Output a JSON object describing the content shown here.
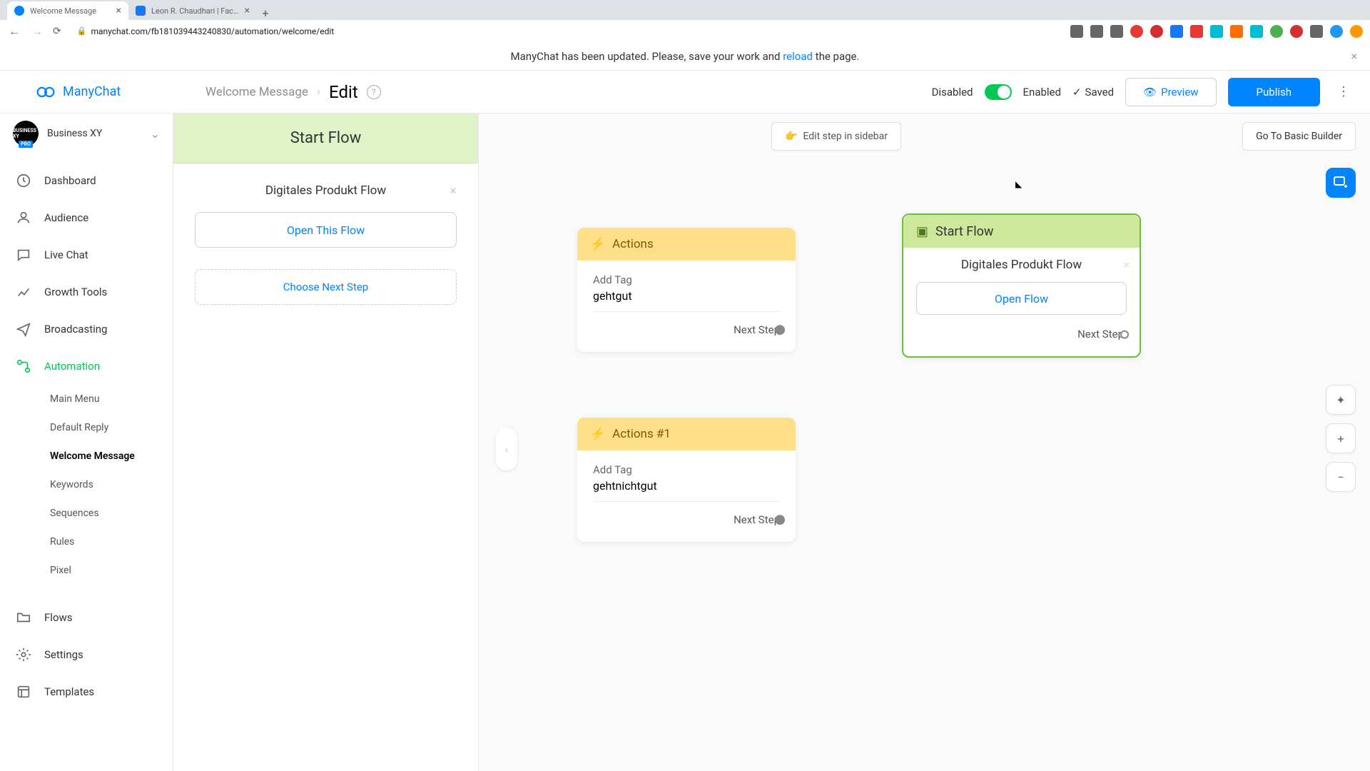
{
  "browser": {
    "tabs": [
      {
        "title": "Welcome Message",
        "active": true
      },
      {
        "title": "Leon R. Chaudhari | Facebook",
        "active": false
      }
    ],
    "url": "manychat.com/fb181039443240830/automation/welcome/edit"
  },
  "banner": {
    "prefix": "ManyChat has been updated. Please, save your work and ",
    "link": "reload",
    "suffix": " the page."
  },
  "brand": "ManyChat",
  "breadcrumb": {
    "parent": "Welcome Message",
    "current": "Edit"
  },
  "topbar": {
    "disabled": "Disabled",
    "enabled": "Enabled",
    "saved": "Saved",
    "preview": "Preview",
    "publish": "Publish"
  },
  "org": {
    "name": "Business XY",
    "badge": "PRO"
  },
  "nav": {
    "dashboard": "Dashboard",
    "audience": "Audience",
    "livechat": "Live Chat",
    "growth": "Growth Tools",
    "broadcasting": "Broadcasting",
    "automation": "Automation",
    "flows": "Flows",
    "settings": "Settings",
    "templates": "Templates"
  },
  "subnav": {
    "mainmenu": "Main Menu",
    "default": "Default Reply",
    "welcome": "Welcome Message",
    "keywords": "Keywords",
    "sequences": "Sequences",
    "rules": "Rules",
    "pixel": "Pixel"
  },
  "side_panel": {
    "title": "Start Flow",
    "flow_name": "Digitales Produkt Flow",
    "open_btn": "Open This Flow",
    "choose": "Choose Next Step"
  },
  "canvas": {
    "edit_sidebar": "Edit step in sidebar",
    "go_basic": "Go To Basic Builder",
    "next_step": "Next Step",
    "add_tag": "Add Tag"
  },
  "nodes": {
    "actions1": {
      "title": "Actions",
      "tag": "gehtgut"
    },
    "actions2": {
      "title": "Actions #1",
      "tag": "gehtnichtgut"
    },
    "startflow": {
      "title": "Start Flow",
      "flow": "Digitales Produkt Flow",
      "open": "Open Flow"
    }
  }
}
